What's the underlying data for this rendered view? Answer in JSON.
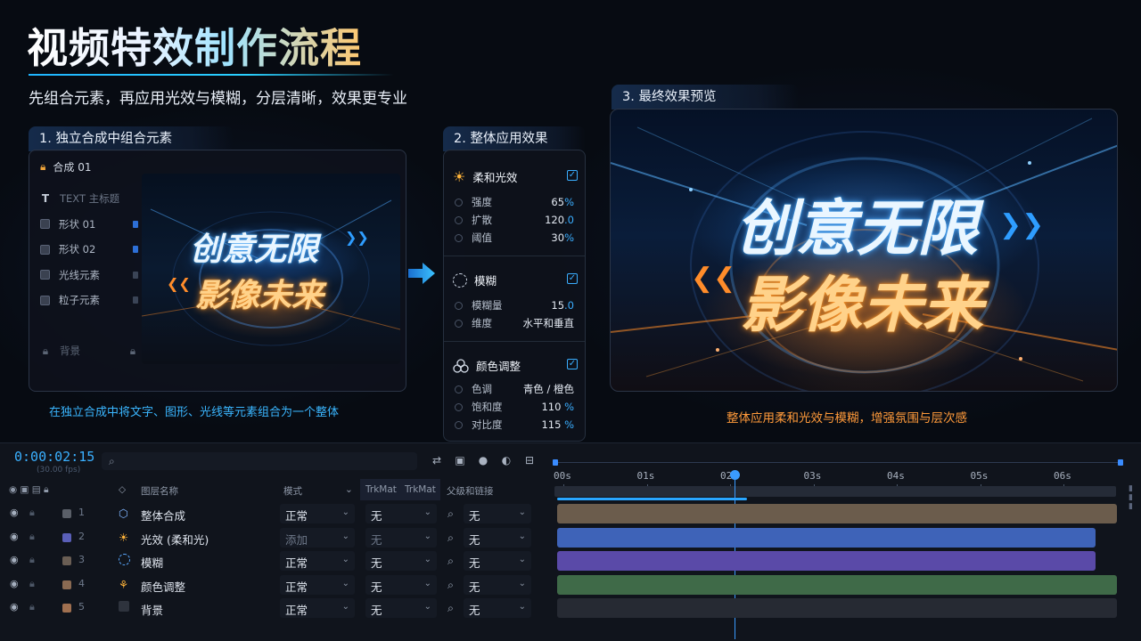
{
  "header": {
    "title": "视频特效制作流程",
    "subtitle": "先组合元素，再应用光效与模糊，分层清晰，效果更专业"
  },
  "panel1": {
    "heading": "1. 独立合成中组合元素",
    "comp_name": "合成 01",
    "layers": [
      {
        "label": "TEXT 主标题",
        "icon": "text-icon"
      },
      {
        "label": "形状 01",
        "icon": "shape-icon"
      },
      {
        "label": "形状 02",
        "icon": "shape-icon"
      },
      {
        "label": "光线元素",
        "icon": "shape-icon"
      },
      {
        "label": "粒子元素",
        "icon": "shape-icon"
      },
      {
        "label": "背景",
        "icon": "lock-icon"
      }
    ],
    "poster_line1": "创意无限",
    "poster_line2": "影像未来",
    "caption": "在独立合成中将文字、图形、光线等元素组合为一个整体"
  },
  "panel2": {
    "heading": "2. 整体应用效果",
    "effects": [
      {
        "name": "柔和光效",
        "icon": "sun-icon",
        "props": [
          {
            "label": "强度",
            "value": "65",
            "unit": "%"
          },
          {
            "label": "扩散",
            "value": "120",
            "unit": ".0"
          },
          {
            "label": "阈值",
            "value": "30",
            "unit": "%"
          }
        ]
      },
      {
        "name": "模糊",
        "icon": "blur-circle-icon",
        "props": [
          {
            "label": "模糊量",
            "value": "15",
            "unit": ".0"
          },
          {
            "label": "维度",
            "value": "水平和垂直",
            "unit": ""
          }
        ]
      },
      {
        "name": "颜色调整",
        "icon": "color-circles-icon",
        "props": [
          {
            "label": "色调",
            "value": "青色 / 橙色",
            "unit": ""
          },
          {
            "label": "饱和度",
            "value": "110",
            "unit": "%"
          },
          {
            "label": "对比度",
            "value": "115",
            "unit": "%"
          }
        ]
      }
    ]
  },
  "panel3": {
    "heading": "3. 最终效果预览",
    "poster_line1": "创意无限",
    "poster_line2": "影像未来",
    "caption": "整体应用柔和光效与模糊，增强氛围与层次感"
  },
  "timeline": {
    "timecode": "0:00:02:15",
    "fps": "(30.00 fps)",
    "columns": {
      "layer_name": "图层名称",
      "mode": "模式",
      "trkmat1": "TrkMat",
      "trkmat2": "TrkMat",
      "parent": "父级和链接"
    },
    "ruler_labels": [
      "00s",
      "01s",
      "02s",
      "03s",
      "04s",
      "05s",
      "06s"
    ],
    "playhead_seconds": 2.15,
    "layers": [
      {
        "num": "1",
        "name": "整体合成",
        "icon": "cube-icon",
        "mode": "正常",
        "trkmat": "无",
        "parent": "无",
        "chip": "#5a5f68",
        "bar_color": "#6b5c4c",
        "bar_end": 6.8
      },
      {
        "num": "2",
        "name": "光效 (柔和光)",
        "icon": "sun-icon",
        "mode": "添加",
        "trkmat": "无",
        "parent": "无",
        "chip": "#5a5fb8",
        "bar_color": "#3e63b8",
        "bar_end": 6.55
      },
      {
        "num": "3",
        "name": "模糊",
        "icon": "blur-circle-icon",
        "mode": "正常",
        "trkmat": "无",
        "parent": "无",
        "chip": "#6a5e54",
        "bar_color": "#5a4aa8",
        "bar_end": 6.55
      },
      {
        "num": "4",
        "name": "颜色调整",
        "icon": "color-circles-icon",
        "mode": "正常",
        "trkmat": "无",
        "parent": "无",
        "chip": "#8a6a52",
        "bar_color": "#3f6a48",
        "bar_end": 6.8
      },
      {
        "num": "5",
        "name": "背景",
        "icon": "solid-square-icon",
        "mode": "正常",
        "trkmat": "无",
        "parent": "无",
        "chip": "#a07050",
        "bar_color": "#262a33",
        "bar_end": 6.8
      }
    ]
  },
  "colors": {
    "accent_blue": "#3ab0ff",
    "accent_orange": "#ff9a3a"
  }
}
